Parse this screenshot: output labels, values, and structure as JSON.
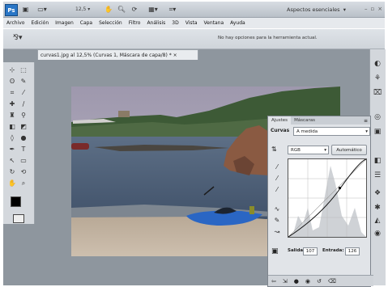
{
  "app": {
    "logo": "Ps",
    "zoom": "12,5",
    "workspace": "Aspectos esenciales"
  },
  "menu": [
    "Archivo",
    "Edición",
    "Imagen",
    "Capa",
    "Selección",
    "Filtro",
    "Análisis",
    "3D",
    "Vista",
    "Ventana",
    "Ayuda"
  ],
  "options_bar": {
    "message": "No hay opciones para la herramienta actual."
  },
  "document": {
    "tab_title": "curvas1.jpg al 12,5% (Curvas 1, Máscara de capa/8) *",
    "close": "×"
  },
  "panel": {
    "tabs": [
      "Ajustes",
      "Máscaras"
    ],
    "title_label": "Curvas",
    "preset_value": "A medida",
    "channel_value": "RGB",
    "auto_button": "Automático",
    "output_label": "Salida:",
    "output_value": "107",
    "input_label": "Entrada:",
    "input_value": "126"
  },
  "icons": [
    "photoshop-logo",
    "bridge-icon",
    "layout-icon",
    "hand-icon",
    "zoom-icon",
    "rotate-icon",
    "arrange-icon",
    "screen-mode-icon"
  ]
}
